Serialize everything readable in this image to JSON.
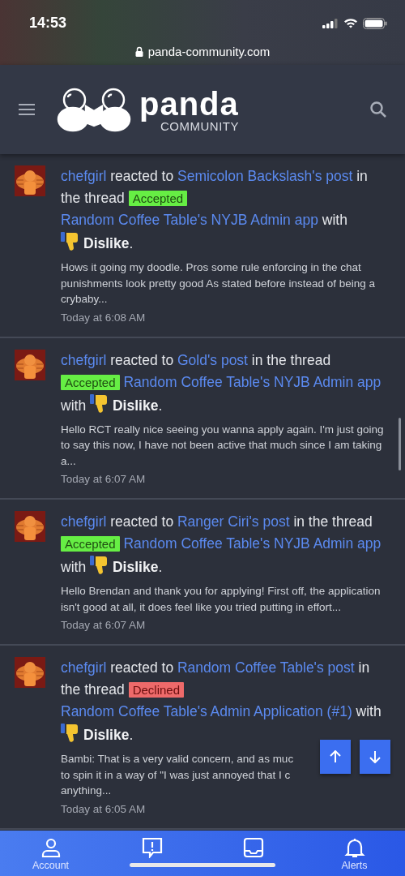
{
  "status_bar": {
    "time": "14:53",
    "url": "panda-community.com"
  },
  "header": {
    "logo_word": "panda",
    "logo_sub": "COMMUNITY"
  },
  "notifications": [
    {
      "actor": "chefgirl",
      "verb": "reacted to",
      "target": "Semicolon Backslash's post",
      "connector": "in the thread",
      "tag": {
        "label": "Accepted",
        "kind": "accepted"
      },
      "thread": "Random Coffee Table's NYJB Admin app",
      "with": "with",
      "reaction": "Dislike",
      "end": ".",
      "excerpt": "Hows it going my doodle. Pros some rule enforcing in the chat punishments look pretty good As stated before instead of being a crybaby...",
      "time": "Today at 6:08 AM"
    },
    {
      "actor": "chefgirl",
      "verb": "reacted to",
      "target": "Gold's post",
      "connector": "in the thread",
      "tag": {
        "label": "Accepted",
        "kind": "accepted"
      },
      "thread": "Random Coffee Table's NYJB Admin app",
      "with": "with",
      "reaction": "Dislike",
      "end": ".",
      "excerpt": "Hello RCT really nice seeing you wanna apply again. I'm just going to say this now, I have not been active that much since I am taking a...",
      "time": "Today at 6:07 AM"
    },
    {
      "actor": "chefgirl",
      "verb": "reacted to",
      "target": "Ranger Ciri's post",
      "connector": "in the thread",
      "tag": {
        "label": "Accepted",
        "kind": "accepted"
      },
      "thread": "Random Coffee Table's NYJB Admin app",
      "with": "with",
      "reaction": "Dislike",
      "end": ".",
      "excerpt": "Hello Brendan and thank you for applying! First off, the application isn't good at all, it does feel like you tried putting in effort...",
      "time": "Today at 6:07 AM"
    },
    {
      "actor": "chefgirl",
      "verb": "reacted to",
      "target": "Random Coffee Table's post",
      "connector": "in the thread",
      "tag": {
        "label": "Declined",
        "kind": "declined"
      },
      "thread": "Random Coffee Table's Admin Application (#1)",
      "with": "with",
      "reaction": "Dislike",
      "end": ".",
      "excerpt_lines": [
        "Bambi: That is a very valid concern, and as muc",
        "to spin it in a way of \"I was just annoyed that I c",
        "anything..."
      ],
      "time": "Today at 6:05 AM"
    }
  ],
  "bottom_nav": [
    {
      "kind": "account",
      "label": "Account"
    },
    {
      "kind": "news"
    },
    {
      "kind": "inbox"
    },
    {
      "kind": "alerts",
      "label": "Alerts"
    }
  ]
}
